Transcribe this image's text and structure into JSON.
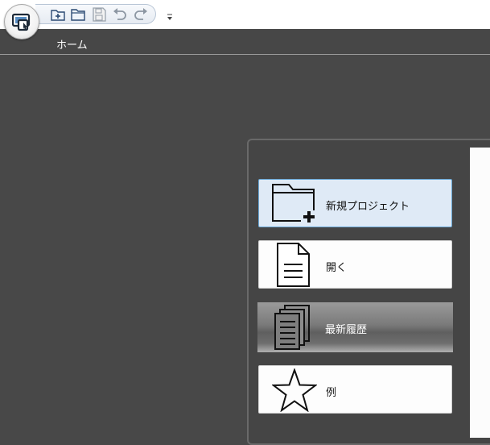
{
  "ribbon": {
    "tabs": [
      {
        "label": "ホーム"
      }
    ]
  },
  "quick_access": {
    "icons": [
      "new-project-icon",
      "open-folder-icon",
      "save-icon",
      "undo-icon",
      "redo-icon",
      "customize-dropdown-icon"
    ]
  },
  "start_menu": {
    "items": [
      {
        "label": "新規プロジェクト",
        "icon": "new-folder-icon"
      },
      {
        "label": "開く",
        "icon": "document-icon"
      },
      {
        "label": "最新履歴",
        "icon": "recent-documents-icon"
      },
      {
        "label": "例",
        "icon": "star-icon"
      }
    ]
  },
  "colors": {
    "background": "#484848",
    "selected_tile": "#dfeaf6",
    "selected_border": "#6aa9d8"
  }
}
